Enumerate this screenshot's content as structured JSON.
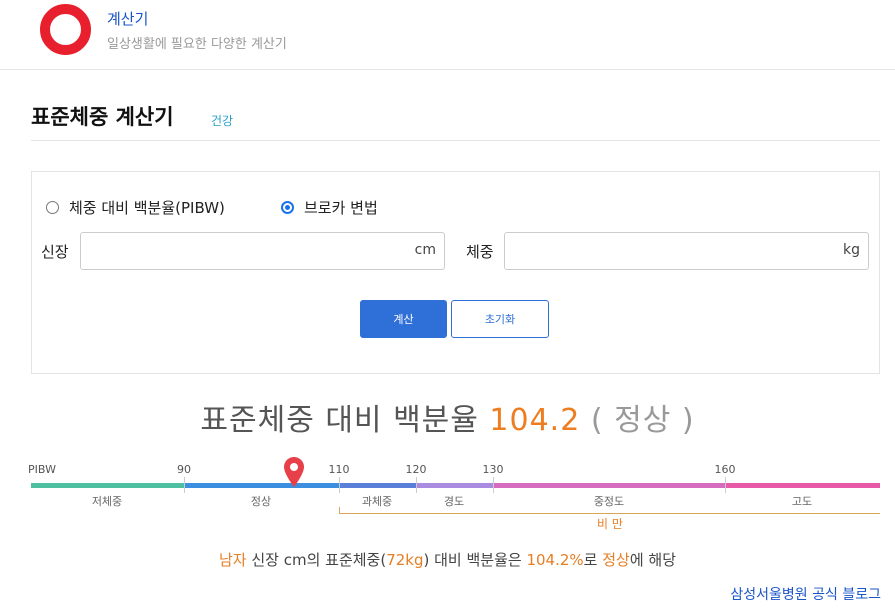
{
  "header": {
    "title": "계산기",
    "subtitle": "일상생활에 필요한 다양한 계산기"
  },
  "page": {
    "title": "표준체중 계산기",
    "tag": "건강"
  },
  "form": {
    "options": [
      {
        "label": "체중 대비 백분율(PIBW)",
        "selected": false
      },
      {
        "label": "브로카 변법",
        "selected": true
      }
    ],
    "height_label": "신장",
    "height_value": "",
    "height_unit": "cm",
    "weight_label": "체중",
    "weight_value": "",
    "weight_unit": "kg",
    "calc_button": "계산",
    "reset_button": "초기화"
  },
  "result": {
    "prefix": "표준체중 대비 백분율",
    "value": "104.2",
    "open_paren": "(",
    "status": "정상",
    "close_paren": ")"
  },
  "gauge": {
    "ticks": [
      "PIBW",
      "90",
      "110",
      "120",
      "130",
      "160"
    ],
    "zones": [
      "저체중",
      "정상",
      "과체중",
      "경도",
      "중정도",
      "고도"
    ],
    "obese_label": "비 만",
    "marker_value": 104.2,
    "colors": {
      "underweight": "#4cc0a0",
      "normal": "#3a8fe0",
      "overweight": "#5a7fd8",
      "mild": "#a98be0",
      "moderate": "#d66bc0",
      "severe": "#e85aa8",
      "marker": "#e8404a",
      "accent": "#ee7d22"
    }
  },
  "summary": {
    "gender": "남자",
    "part1": " 신장 cm의 표준체중(",
    "std_weight": "72kg",
    "part2": ") 대비 백분율은 ",
    "percent": "104.2%",
    "part3": "로 ",
    "status": "정상",
    "part4": "에 해당"
  },
  "source": {
    "label": "삼성서울병원 공식 블로그"
  }
}
